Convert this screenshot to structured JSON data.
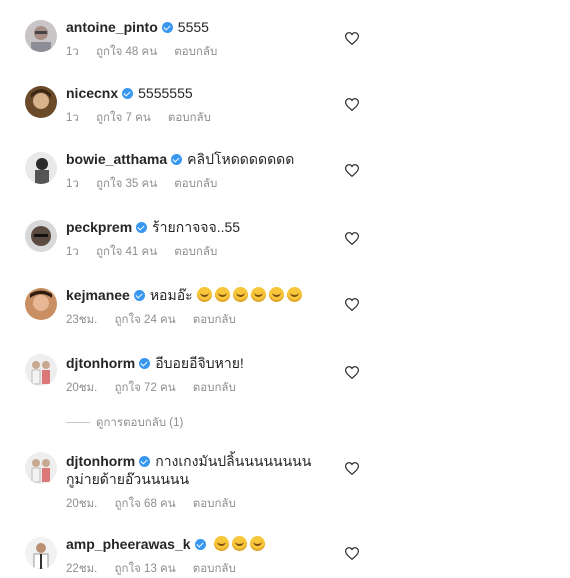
{
  "colors": {
    "verified": "#3897f0",
    "meta": "#8e8e8e",
    "text": "#262626"
  },
  "comments": [
    {
      "user": "antoine_pinto",
      "text": "5555",
      "time": "1ว",
      "likes": "ถูกใจ 48 คน",
      "reply": "ตอบกลับ"
    },
    {
      "user": "nicecnx",
      "text": "5555555",
      "time": "1ว",
      "likes": "ถูกใจ 7 คน",
      "reply": "ตอบกลับ"
    },
    {
      "user": "bowie_atthama",
      "text": "คลิปโหดดดดดดด",
      "time": "1ว",
      "likes": "ถูกใจ 35 คน",
      "reply": "ตอบกลับ"
    },
    {
      "user": "peckprem",
      "text": "ร้ายกาจจจ..55",
      "time": "1ว",
      "likes": "ถูกใจ 41 คน",
      "reply": "ตอบกลับ"
    },
    {
      "user": "kejmanee",
      "text": "หอมอ๊ะ",
      "emoji_count": 6,
      "emoji": "rolling-laughing-emoji",
      "time": "23ชม.",
      "likes": "ถูกใจ 24 คน",
      "reply": "ตอบกลับ"
    },
    {
      "user": "djtonhorm",
      "text": "อีบอยอีจิบหาย!",
      "time": "20ชม.",
      "likes": "ถูกใจ 72 คน",
      "reply": "ตอบกลับ"
    },
    {
      "user": "djtonhorm",
      "text": "กางเกงมันปลิ้นนนนนนนน กูม่ายด้ายอ๊วนนนนน",
      "time": "20ชม.",
      "likes": "ถูกใจ 68 คน",
      "reply": "ตอบกลับ"
    },
    {
      "user": "amp_pheerawas_k",
      "text": "",
      "emoji_count": 3,
      "emoji": "tears-of-joy-emoji",
      "time": "22ชม.",
      "likes": "ถูกใจ 13 คน",
      "reply": "ตอบกลับ"
    }
  ],
  "view_replies": "ดูการตอบกลับ (1)"
}
